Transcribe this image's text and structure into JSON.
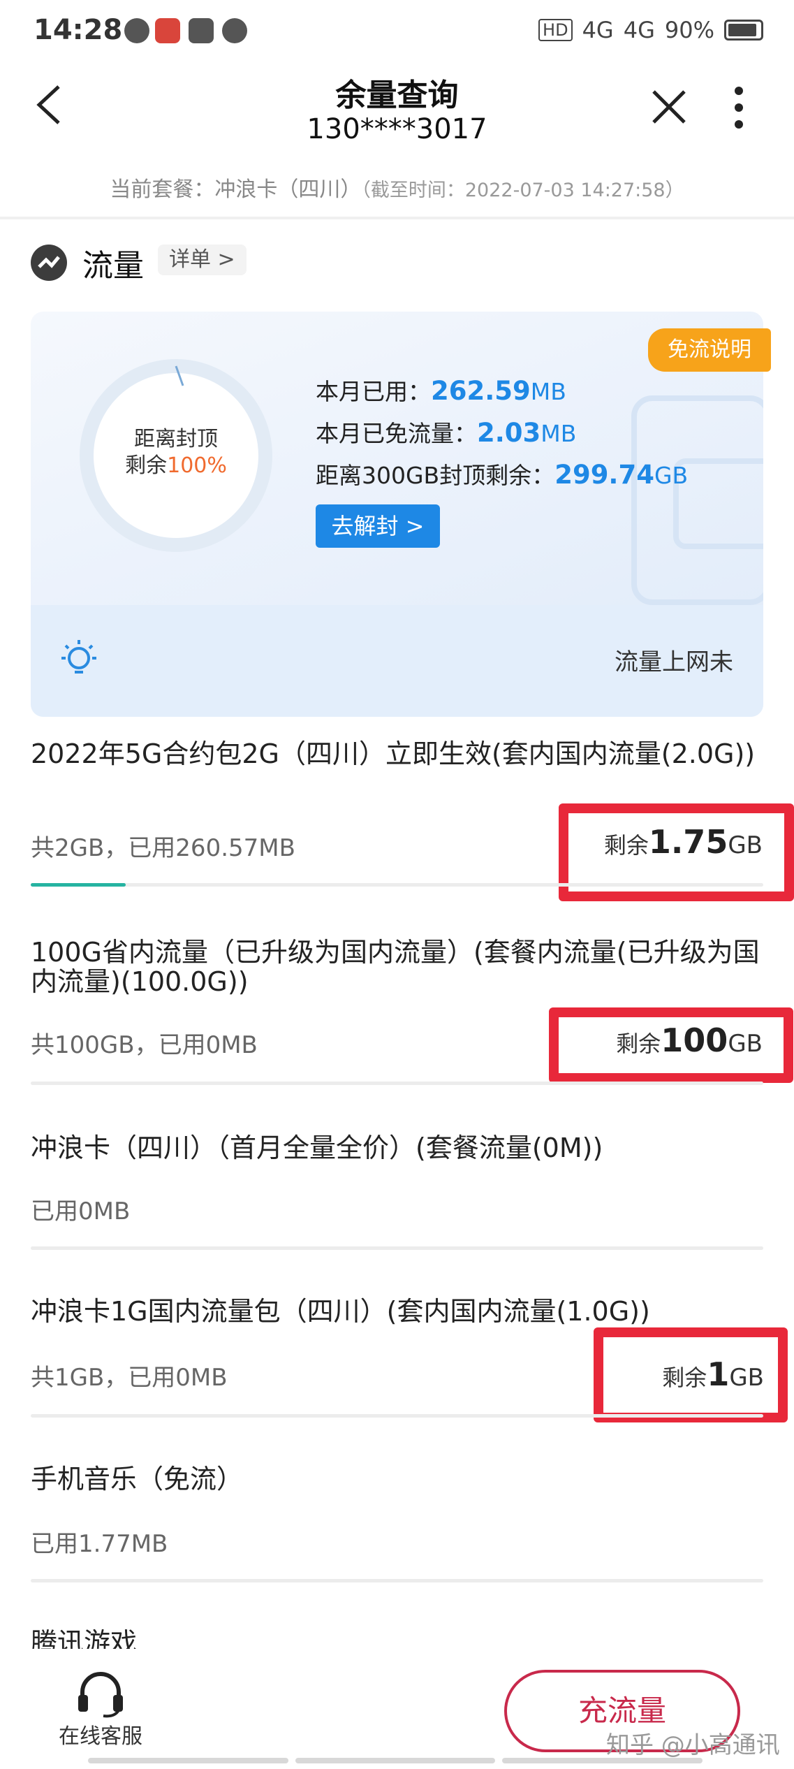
{
  "status_bar": {
    "time": "14:28",
    "network": "4G",
    "battery": "90%"
  },
  "header": {
    "title": "余量查询",
    "phone": "130****3017",
    "plan_label": "当前套餐：冲浪卡（四川）",
    "plan_time": "（截至时间：2022-07-03 14:27:58）"
  },
  "section": {
    "title": "流量",
    "detail_label": "详单 >"
  },
  "summary_card": {
    "badge": "免流说明",
    "ring_line1": "距离封顶",
    "ring_line2": "剩余",
    "ring_pct": "100%",
    "used_label": "本月已用：",
    "used_value": "262.59",
    "used_unit": "MB",
    "free_label": "本月已免流量：",
    "free_value": "2.03",
    "free_unit": "MB",
    "cap_label": "距离300GB封顶剩余：",
    "cap_value": "299.74",
    "cap_unit": "GB",
    "unlock_label": "去解封 >",
    "tip": "流量上网未",
    "accent_color": "#1e88e5"
  },
  "items": [
    {
      "title": "2022年5G合约包2G（四川）立即生效(套内国内流量(2.0G))",
      "sub": "共2GB，已用260.57MB",
      "remain_label": "剩余",
      "remain_value": "1.75",
      "remain_unit": "GB",
      "used_fraction": 0.13
    },
    {
      "title": "100G省内流量（已升级为国内流量）(套餐内流量(已升级为国内流量)(100.0G))",
      "sub": "共100GB，已用0MB",
      "remain_label": "剩余",
      "remain_value": "100",
      "remain_unit": "GB",
      "used_fraction": 0
    },
    {
      "title": "冲浪卡（四川）（首月全量全价）(套餐流量(0M))",
      "sub": "已用0MB"
    },
    {
      "title": "冲浪卡1G国内流量包（四川）(套内国内流量(1.0G))",
      "sub": "共1GB，已用0MB",
      "remain_label": "剩余",
      "remain_value": "1",
      "remain_unit": "GB",
      "used_fraction": 0
    },
    {
      "title": "手机音乐（免流）",
      "sub": "已用1.77MB"
    },
    {
      "title": "腾讯游戏"
    }
  ],
  "bottom": {
    "service_label": "在线客服",
    "topup_label": "充流量",
    "watermark": "知乎 @小高通讯"
  }
}
